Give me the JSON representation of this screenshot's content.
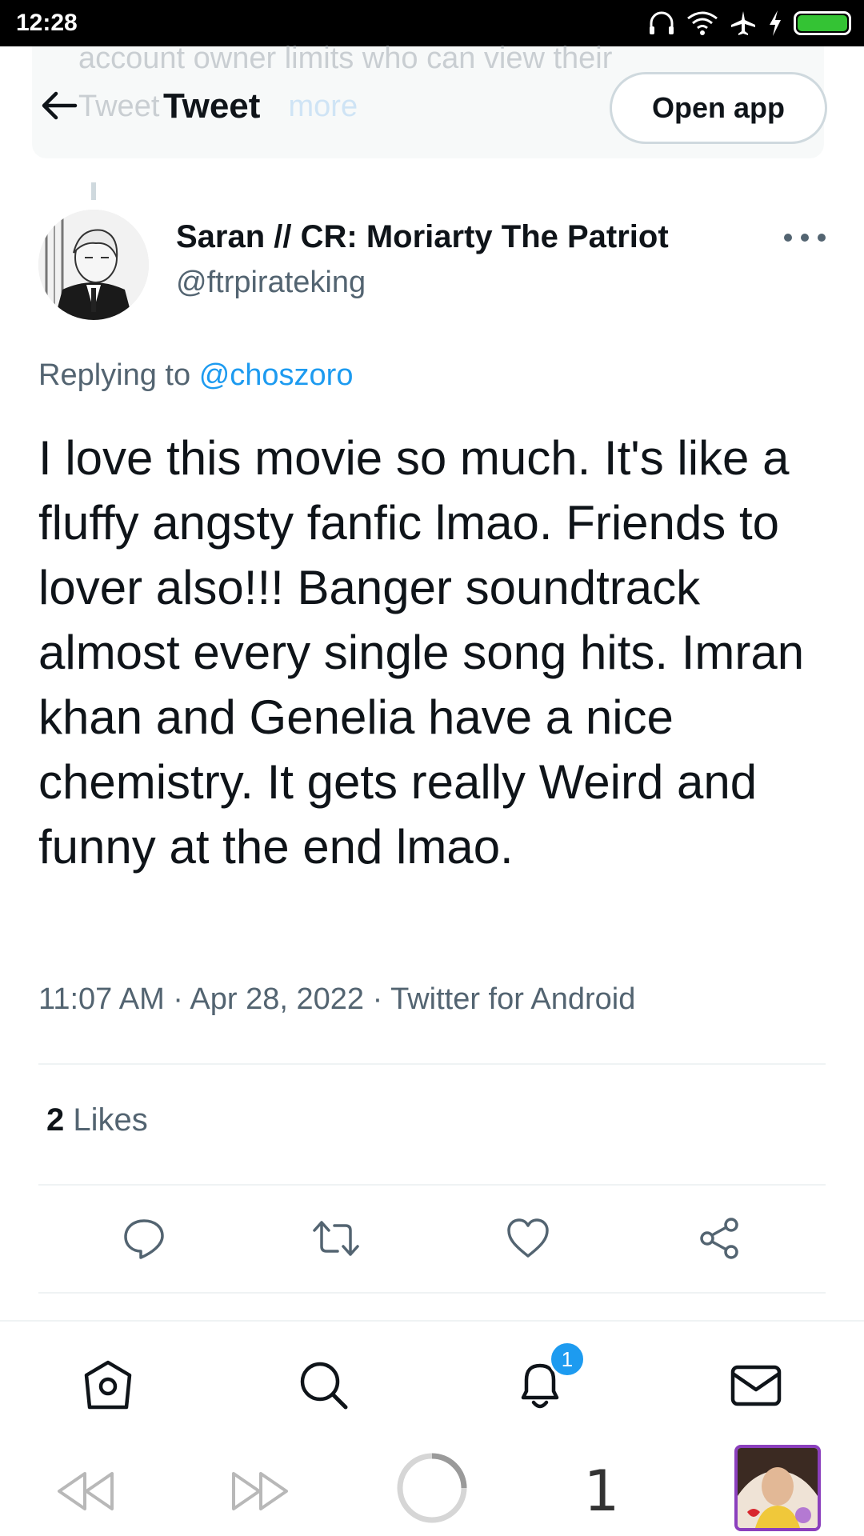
{
  "status_bar": {
    "time": "12:28"
  },
  "background_card": {
    "line1": "account owner limits who can view their",
    "line2_prefix": "Tweet",
    "line2_link": "more"
  },
  "header": {
    "title": "Tweet",
    "open_app_label": "Open app"
  },
  "tweet": {
    "author_name": "Saran // CR: Moriarty The Patriot",
    "author_handle": "@ftrpirateking",
    "replying_prefix": "Replying to",
    "replying_to": "@choszoro",
    "text": "I love this movie so much. It's like a fluffy angsty fanfic lmao. Friends to lover also!!! Banger soundtrack almost every single song hits. Imran khan and Genelia have a nice chemistry. It gets really Weird and funny at the end lmao.",
    "timestamp": "11:07 AM · Apr 28, 2022 · Twitter for Android",
    "likes_count": "2",
    "likes_label": "Likes"
  },
  "bottom_nav": {
    "notification_badge": "1"
  },
  "browser_bar": {
    "tab_count": "1"
  },
  "colors": {
    "accent": "#1d9bf0",
    "text": "#0f1419",
    "secondary": "#536471",
    "border": "#cfd9de",
    "divider": "#eff3f4"
  },
  "icons": [
    "back-arrow-icon",
    "more-icon",
    "reply-icon",
    "retweet-icon",
    "like-icon",
    "share-icon",
    "home-icon",
    "search-icon",
    "bell-icon",
    "mail-icon",
    "rewind-icon",
    "forward-icon",
    "loading-icon"
  ]
}
